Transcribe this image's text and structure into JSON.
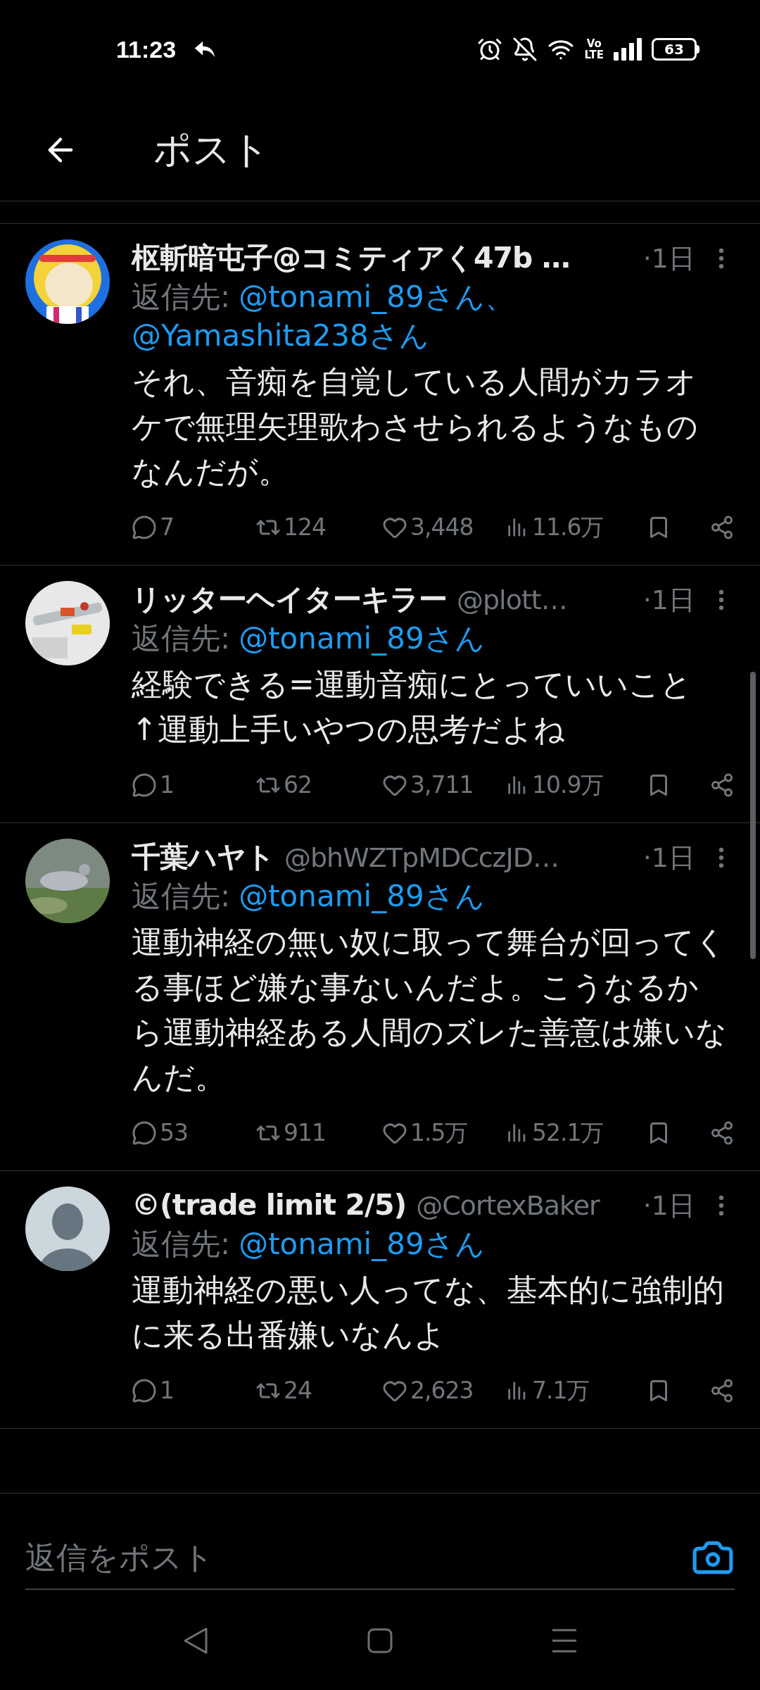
{
  "status_bar": {
    "time": "11:23",
    "network": [
      "Vo",
      "LTE"
    ],
    "battery": "63"
  },
  "header": {
    "title": "ポスト"
  },
  "posts": [
    {
      "avatar": {
        "kind": "picture"
      },
      "name": "枢斬暗屯子@コミティアく47b …",
      "time": "·1日",
      "reply_label": "返信先:",
      "reply_to": [
        "@tonami_89さん、",
        "@Yamashita238さん"
      ],
      "text": "それ、音痴を自覚している人間がカラオケで無理矢理歌わさせられるようなものなんだが。",
      "replies": "7",
      "reposts": "124",
      "likes": "3,448",
      "views": "11.6万"
    },
    {
      "avatar": {
        "kind": "picture"
      },
      "name": "リッターヘイターキラー",
      "handle": "@plott…",
      "time": "·1日",
      "reply_label": "返信先:",
      "reply_to": [
        "@tonami_89さん"
      ],
      "text": "経験できる=運動音痴にとっていいこと\n↑運動上手いやつの思考だよね",
      "replies": "1",
      "reposts": "62",
      "likes": "3,711",
      "views": "10.9万"
    },
    {
      "avatar": {
        "kind": "picture"
      },
      "name": "千葉ハヤト",
      "handle": "@bhWZTpMDCczJD…",
      "time": "·1日",
      "reply_label": "返信先:",
      "reply_to": [
        "@tonami_89さん"
      ],
      "text": "運動神経の無い奴に取って舞台が回ってくる事ほど嫌な事ないんだよ。こうなるから運動神経ある人間のズレた善意は嫌いなんだ。",
      "replies": "53",
      "reposts": "911",
      "likes": "1.5万",
      "views": "52.1万"
    },
    {
      "avatar": {
        "kind": "default"
      },
      "name": "©(trade limit 2/5)",
      "handle": "@CortexBaker",
      "time": "·1日",
      "reply_label": "返信先:",
      "reply_to": [
        "@tonami_89さん"
      ],
      "text": "運動神経の悪い人ってな、基本的に強制的に来る出番嫌いなんよ",
      "replies": "1",
      "reposts": "24",
      "likes": "2,623",
      "views": "7.1万"
    }
  ],
  "composer": {
    "placeholder": "返信をポスト"
  }
}
